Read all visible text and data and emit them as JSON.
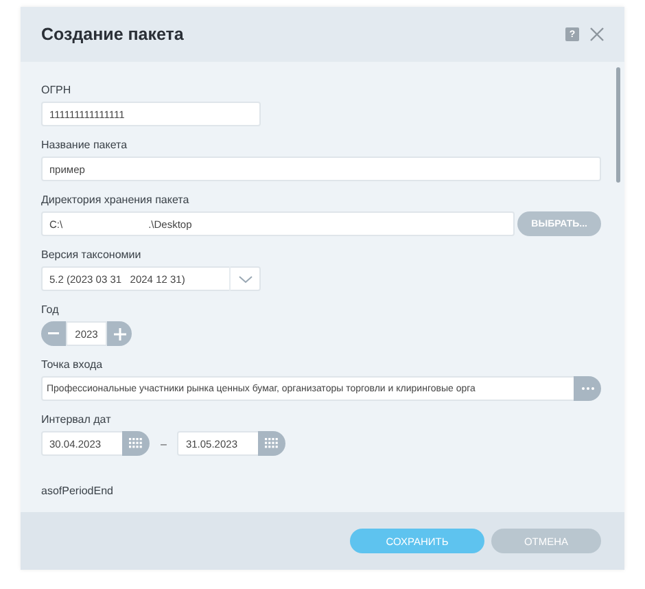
{
  "dialog": {
    "title": "Создание пакета",
    "help": "?"
  },
  "fields": [
    {
      "kind": "short",
      "label": "ОГРН",
      "value": "111111111111111"
    },
    {
      "kind": "text",
      "label": "Название пакета",
      "value": "пример"
    },
    {
      "kind": "path",
      "label": "Директория хранения пакета",
      "value": "C:\\                              .\\Desktop",
      "button": "ВЫБРАТЬ..."
    },
    {
      "kind": "select",
      "label": "Версия таксономии",
      "value": "5.2 (2023 03 31   2024 12 31)"
    },
    {
      "kind": "stepper",
      "label": "Год",
      "value": "2023"
    },
    {
      "kind": "picker",
      "label": "Точка входа",
      "value": "Профессиональные участники рынка ценных бумаг, организаторы торговли и клиринговые орга"
    },
    {
      "kind": "range",
      "label": "Интервал дат",
      "from": "30.04.2023",
      "separator": "–",
      "to": "31.05.2023"
    },
    {
      "kind": "heading",
      "label": "asofPeriodEnd"
    }
  ],
  "buttons": [
    {
      "label": "СОХРАНИТЬ",
      "primary": true
    },
    {
      "label": "ОТМЕНА",
      "primary": false
    }
  ]
}
